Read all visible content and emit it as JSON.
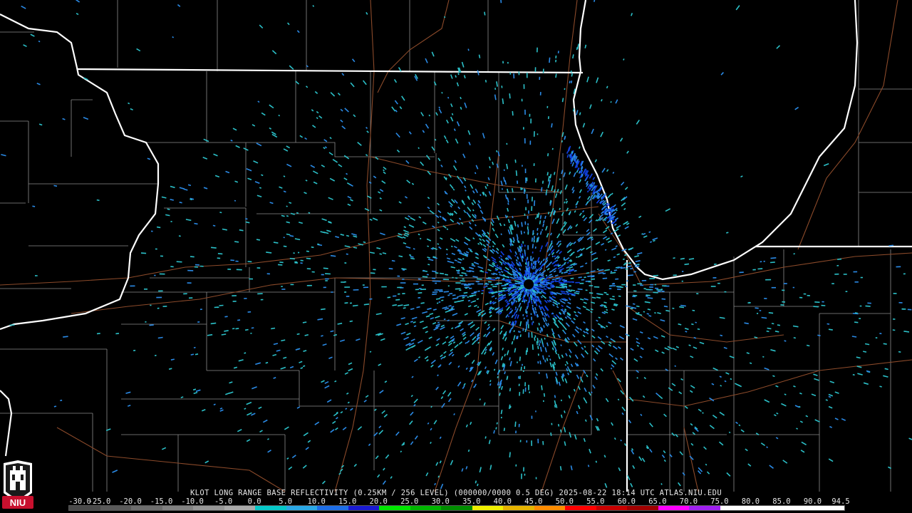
{
  "product": {
    "caption": "KLOT LONG RANGE BASE REFLECTIVITY (0.25KM / 256 LEVEL) (000000/0000 0.5 DEG) 2025-08-22 18:14 UTC  ATLAS.NIU.EDU",
    "logo_text": "NIU"
  },
  "scale": {
    "labels": [
      "-30.0",
      "-25.0",
      "-20.0",
      "-15.0",
      "-10.0",
      "-5.0",
      "0.0",
      "5.0",
      "10.0",
      "15.0",
      "20.0",
      "25.0",
      "30.0",
      "35.0",
      "40.0",
      "45.0",
      "50.0",
      "55.0",
      "60.0",
      "65.0",
      "70.0",
      "75.0",
      "80.0",
      "85.0",
      "90.0",
      "94.5"
    ],
    "colors": [
      "#4a4a4a",
      "#5a5a5a",
      "#6e6e6e",
      "#828282",
      "#969696",
      "#aaaaaa",
      "#06c8c8",
      "#2ba8e6",
      "#1e6ee6",
      "#1a1ad2",
      "#00e600",
      "#00b400",
      "#008c00",
      "#f0f000",
      "#e6b400",
      "#ff8c00",
      "#ff0000",
      "#c80000",
      "#a00000",
      "#ff00ff",
      "#a020f0",
      "#ffffff",
      "#ffffff",
      "#ffffff",
      "#ffffff"
    ]
  },
  "colors": {
    "background": "#000000",
    "state_border": "#ffffff",
    "county_border": "#8c8c8c",
    "highway": "#8b4a2a",
    "echo_light": "#2bc0c8",
    "echo_mid": "#2a8ae6",
    "echo_strong": "#1040e0",
    "logo_red": "#c8102e"
  }
}
